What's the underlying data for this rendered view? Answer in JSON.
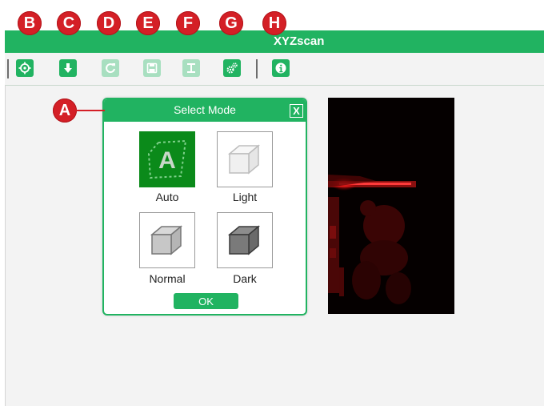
{
  "app": {
    "title": "XYZscan"
  },
  "markers": {
    "a": "A",
    "b": "B",
    "c": "C",
    "d": "D",
    "e": "E",
    "f": "F",
    "g": "G",
    "h": "H"
  },
  "toolbar": {
    "buttons": [
      {
        "icon": "crosshair-icon",
        "enabled": true
      },
      {
        "icon": "download-arrow-icon",
        "enabled": true
      },
      {
        "icon": "refresh-icon",
        "enabled": false
      },
      {
        "icon": "save-icon",
        "enabled": false
      },
      {
        "icon": "text-cursor-icon",
        "enabled": false
      },
      {
        "icon": "gear-icon",
        "enabled": true
      },
      {
        "icon": "info-icon",
        "enabled": true
      }
    ]
  },
  "dialog": {
    "title": "Select Mode",
    "close_label": "X",
    "modes": [
      {
        "label": "Auto",
        "icon": "auto-mode-icon",
        "selected": true
      },
      {
        "label": "Light",
        "icon": "light-cube-icon",
        "selected": false
      },
      {
        "label": "Normal",
        "icon": "normal-cube-icon",
        "selected": false
      },
      {
        "label": "Dark",
        "icon": "dark-cube-icon",
        "selected": false
      }
    ],
    "auto_glyph": "A",
    "ok_label": "OK"
  },
  "colors": {
    "accent": "#21b361",
    "marker": "#d41f26",
    "selected": "#0b8a1a"
  }
}
